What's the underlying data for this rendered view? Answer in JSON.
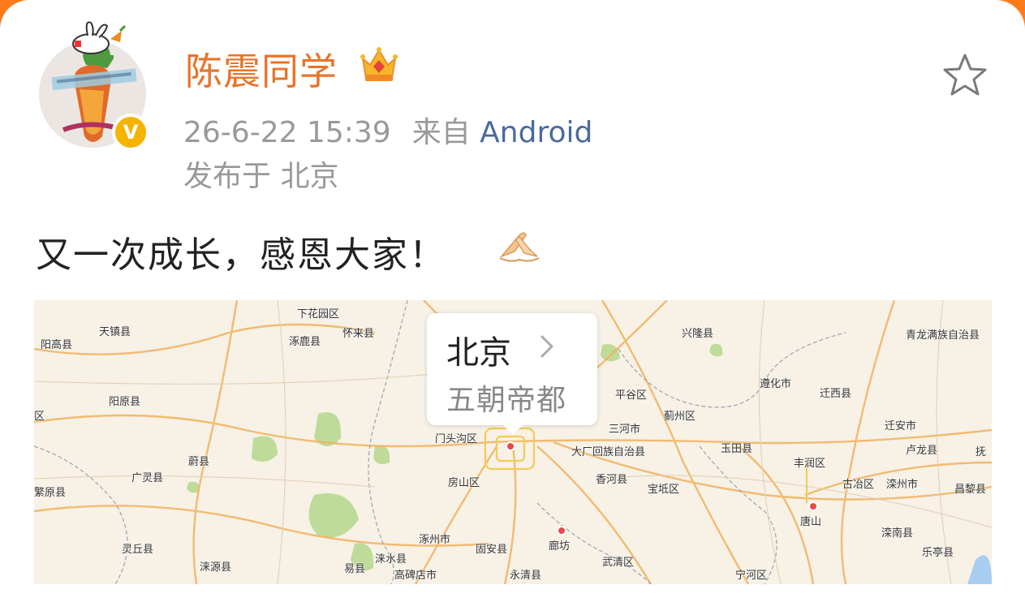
{
  "post": {
    "username": "陈震同学",
    "timestamp": "26-6-22 15:39",
    "source_prefix": "来自",
    "client": "Android",
    "location": "发布于 北京",
    "text": "又一次成长，感恩大家！",
    "verified_badge": "V"
  },
  "icons": {
    "crown": "crown-icon",
    "star": "star-icon",
    "emoji": "pray-hands-emoji",
    "chevron": "chevron-right-icon"
  },
  "colors": {
    "username": "#e8742a",
    "client_link": "#4b6a9e",
    "verified": "#f5b400"
  },
  "map": {
    "bubble_title": "北京",
    "bubble_subtitle": "五朝帝都",
    "labels": [
      "阳高县",
      "天镇县",
      "下花园区",
      "怀来县",
      "涿鹿县",
      "兴隆县",
      "青龙满族自治县",
      "阳原县",
      "遵化市",
      "迁西县",
      "平谷区",
      "蓟州区",
      "三河市",
      "迁安市",
      "卢龙县",
      "门头沟区",
      "玉田县",
      "丰润区",
      "大厂回族自治县",
      "蔚县",
      "广灵县",
      "房山区",
      "香河县",
      "宝坻区",
      "古冶区",
      "滦州市",
      "昌黎县",
      "唐山",
      "灵丘县",
      "涿州市",
      "固安县",
      "廊坊",
      "滦南县",
      "涞源县",
      "易县",
      "涞水县",
      "武清区",
      "乐亭县",
      "高碑店市",
      "永清县",
      "宁河区",
      "区",
      "繁原县",
      "抚"
    ]
  }
}
